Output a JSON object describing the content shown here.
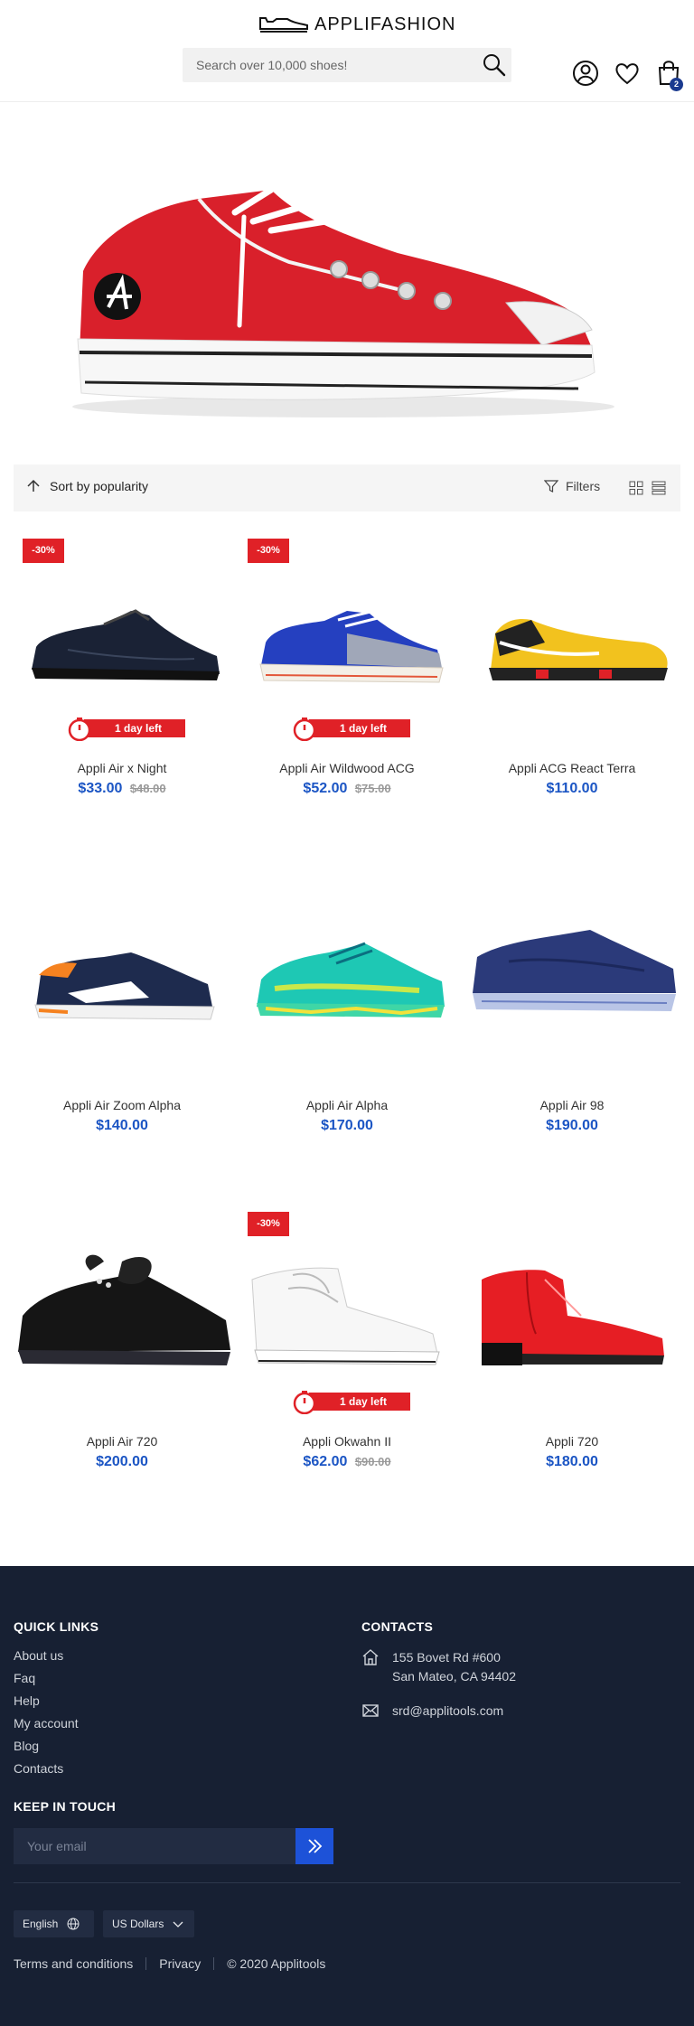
{
  "header": {
    "logo_text": "APPLIFASHION",
    "search_placeholder": "Search over 10,000 shoes!",
    "cart_count": "2"
  },
  "toolbar": {
    "sort_label": "Sort by popularity",
    "filters_label": "Filters"
  },
  "products": [
    {
      "name": "Appli Air x Night",
      "price": "$33.00",
      "old_price": "$48.00",
      "discount": "-30%",
      "timer": "1 day left"
    },
    {
      "name": "Appli Air Wildwood ACG",
      "price": "$52.00",
      "old_price": "$75.00",
      "discount": "-30%",
      "timer": "1 day left"
    },
    {
      "name": "Appli ACG React Terra",
      "price": "$110.00"
    },
    {
      "name": "Appli Air Zoom Alpha",
      "price": "$140.00"
    },
    {
      "name": "Appli Air Alpha",
      "price": "$170.00"
    },
    {
      "name": "Appli Air 98",
      "price": "$190.00"
    },
    {
      "name": "Appli Air 720",
      "price": "$200.00"
    },
    {
      "name": "Appli Okwahn II",
      "price": "$62.00",
      "old_price": "$90.00",
      "discount": "-30%",
      "timer": "1 day left"
    },
    {
      "name": "Appli 720",
      "price": "$180.00"
    }
  ],
  "footer": {
    "quick_links_title": "QUICK LINKS",
    "quick_links": [
      "About us",
      "Faq",
      "Help",
      "My account",
      "Blog",
      "Contacts"
    ],
    "contacts_title": "CONTACTS",
    "address_line1": "155 Bovet Rd #600",
    "address_line2": "San Mateo, CA 94402",
    "email": "srd@applitools.com",
    "keep_in_touch_title": "KEEP IN TOUCH",
    "email_placeholder": "Your email",
    "language": "English",
    "currency": "US Dollars",
    "terms": "Terms and conditions",
    "privacy": "Privacy",
    "copyright": "© 2020 Applitools"
  },
  "colors": {
    "accent": "#1b55c4",
    "sale_red": "#e02127",
    "footer_bg": "#172033"
  }
}
